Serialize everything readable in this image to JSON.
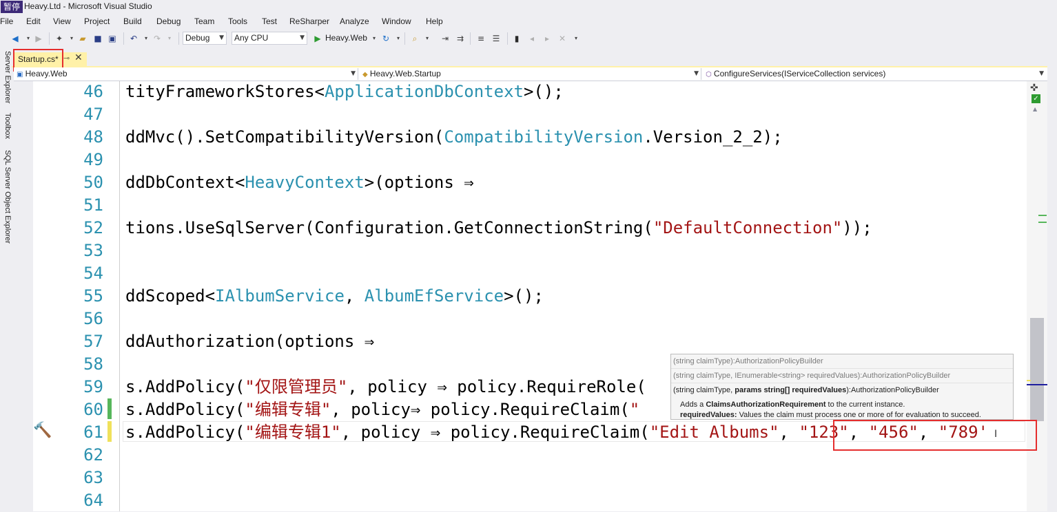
{
  "window": {
    "title": "Heavy.Ltd - Microsoft Visual Studio",
    "icon_text": "暂停"
  },
  "menu": [
    "File",
    "Edit",
    "View",
    "Project",
    "Build",
    "Debug",
    "Team",
    "Tools",
    "Test",
    "ReSharper",
    "Analyze",
    "Window",
    "Help"
  ],
  "toolbar": {
    "config": "Debug",
    "platform": "Any CPU",
    "run_target": "Heavy.Web"
  },
  "side_tabs": [
    "Server Explorer",
    "Toolbox",
    "SQL Server Object Explorer"
  ],
  "tab": {
    "label": "Startup.cs*"
  },
  "navbar": {
    "project": "Heavy.Web",
    "type": "Heavy.Web.Startup",
    "member": "ConfigureServices(IServiceCollection services)"
  },
  "tooltip": {
    "overloads": [
      "(string claimType):AuthorizationPolicyBuilder",
      "(string claimType, IEnumerable<string> requiredValues):AuthorizationPolicyBuilder"
    ],
    "selected_prefix": "(string claimType, ",
    "selected_bold": "params string[] requiredValues",
    "selected_suffix": "):AuthorizationPolicyBuilder",
    "summary_prefix": "Adds a ",
    "summary_bold": "ClaimsAuthorizationRequirement",
    "summary_suffix": " to the current instance.",
    "param_name": "requiredValues:",
    "param_desc": " Values the claim must process one or more of for evaluation to succeed."
  },
  "code": {
    "lines": [
      {
        "num": "46",
        "segs": [
          [
            "tityFrameworkStores<",
            ""
          ],
          [
            "ApplicationDbContext",
            "type"
          ],
          [
            ">();",
            ""
          ]
        ]
      },
      {
        "num": "47",
        "segs": []
      },
      {
        "num": "48",
        "segs": [
          [
            "ddMvc().SetCompatibilityVersion(",
            ""
          ],
          [
            "CompatibilityVersion",
            "type"
          ],
          [
            ".Version_2_2);",
            ""
          ]
        ]
      },
      {
        "num": "49",
        "segs": []
      },
      {
        "num": "50",
        "segs": [
          [
            "ddDbContext<",
            ""
          ],
          [
            "HeavyContext",
            "type"
          ],
          [
            ">(options ⇒",
            ""
          ]
        ]
      },
      {
        "num": "51",
        "segs": []
      },
      {
        "num": "52",
        "segs": [
          [
            "tions.UseSqlServer(Configuration.GetConnectionString(",
            ""
          ],
          [
            "\"DefaultConnection\"",
            "str"
          ],
          [
            "));",
            ""
          ]
        ]
      },
      {
        "num": "53",
        "segs": []
      },
      {
        "num": "54",
        "segs": []
      },
      {
        "num": "55",
        "segs": [
          [
            "ddScoped<",
            ""
          ],
          [
            "IAlbumService",
            "type"
          ],
          [
            ", ",
            ""
          ],
          [
            "AlbumEfService",
            "type"
          ],
          [
            ">();",
            ""
          ]
        ]
      },
      {
        "num": "56",
        "segs": []
      },
      {
        "num": "57",
        "segs": [
          [
            "ddAuthorization(options ⇒",
            ""
          ]
        ]
      },
      {
        "num": "58",
        "segs": []
      },
      {
        "num": "59",
        "segs": [
          [
            "s.AddPolicy(",
            ""
          ],
          [
            "\"仅限管理员\"",
            "str"
          ],
          [
            ", policy ⇒ policy.RequireRole(",
            ""
          ]
        ]
      },
      {
        "num": "60",
        "segs": [
          [
            "s.AddPolicy(",
            ""
          ],
          [
            "\"编辑专辑\"",
            "str"
          ],
          [
            ", policy⇒ policy.RequireClaim(",
            ""
          ],
          [
            "\"",
            "str"
          ]
        ]
      },
      {
        "num": "61",
        "segs": [
          [
            "s.AddPolicy(",
            ""
          ],
          [
            "\"编辑专辑1\"",
            "str"
          ],
          [
            ", policy ⇒ policy.RequireClaim(",
            ""
          ],
          [
            "\"Edit Albums\"",
            "str"
          ],
          [
            ", ",
            ""
          ],
          [
            "\"123\"",
            "str"
          ],
          [
            ", ",
            ""
          ],
          [
            "\"456\"",
            "str"
          ],
          [
            ", ",
            ""
          ],
          [
            "\"789'",
            "str"
          ]
        ]
      },
      {
        "num": "62",
        "segs": []
      },
      {
        "num": "63",
        "segs": []
      },
      {
        "num": "64",
        "segs": []
      }
    ]
  }
}
